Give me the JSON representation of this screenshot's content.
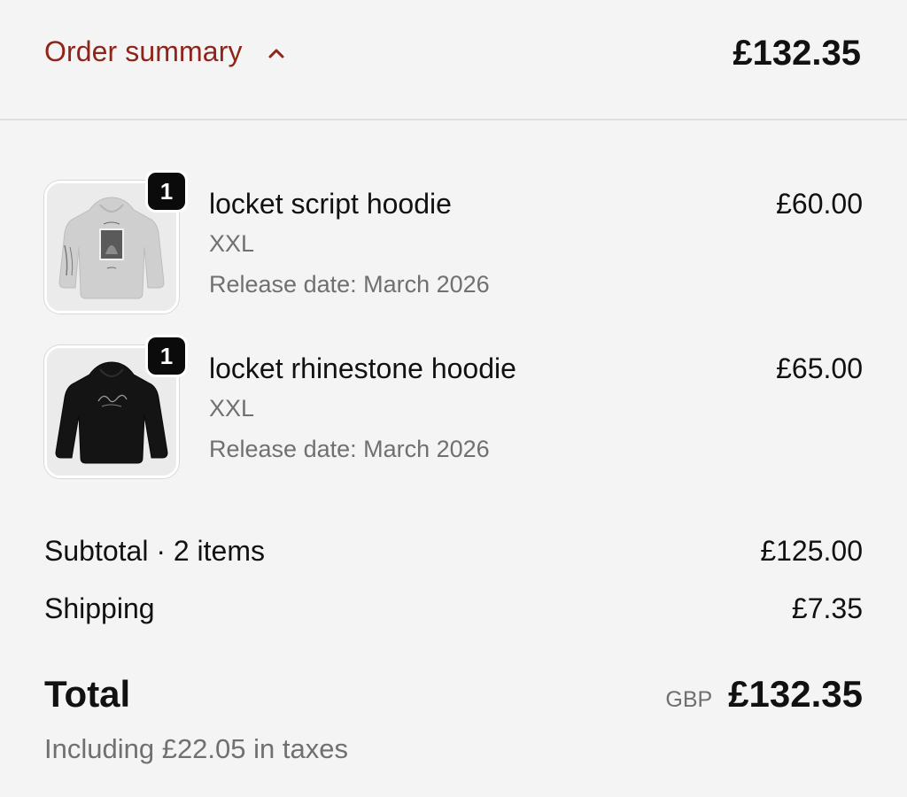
{
  "header": {
    "toggle_label": "Order summary",
    "toggle_icon": "chevron-up-icon",
    "total": "£132.35"
  },
  "items": [
    {
      "quantity": "1",
      "name": "locket script hoodie",
      "variant": "XXL",
      "release": "Release date: March 2026",
      "price": "£60.00",
      "image": "grey-hoodie-image"
    },
    {
      "quantity": "1",
      "name": "locket rhinestone hoodie",
      "variant": "XXL",
      "release": "Release date: March 2026",
      "price": "£65.00",
      "image": "black-hoodie-image"
    }
  ],
  "totals": {
    "subtotal_label": "Subtotal · 2 items",
    "subtotal_value": "£125.00",
    "shipping_label": "Shipping",
    "shipping_value": "£7.35",
    "total_label": "Total",
    "currency": "GBP",
    "total_value": "£132.35",
    "tax_note": "Including £22.05 in taxes"
  },
  "colors": {
    "accent": "#8f2419",
    "background": "#f4f4f4",
    "badge": "#0b0b0b"
  }
}
